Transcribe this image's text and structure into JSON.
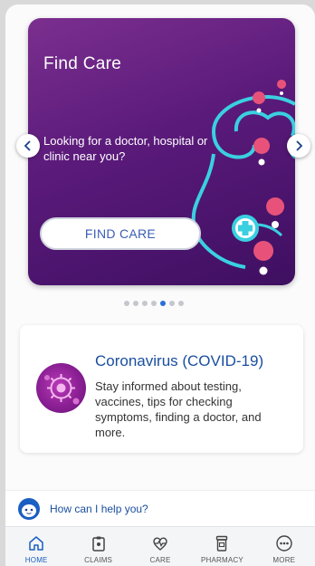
{
  "carousel": {
    "title": "Find Care",
    "description": "Looking for a doctor, hospital or clinic near you?",
    "button_label": "FIND CARE",
    "slide_count": 7,
    "active_slide": 5,
    "prev_icon": "chevron-left-icon",
    "next_icon": "chevron-right-icon"
  },
  "covid": {
    "title": "Coronavirus (COVID-19)",
    "text": "Stay informed about testing, vaccines, tips for checking symptoms, finding a doctor, and more.",
    "icon": "virus-icon"
  },
  "help": {
    "text": "How can I help you?",
    "icon": "assistant-avatar-icon"
  },
  "tabs": [
    {
      "label": "HOME",
      "icon": "home-icon",
      "active": true
    },
    {
      "label": "CLAIMS",
      "icon": "clipboard-icon",
      "active": false
    },
    {
      "label": "CARE",
      "icon": "heart-pulse-icon",
      "active": false
    },
    {
      "label": "PHARMACY",
      "icon": "pill-bottle-icon",
      "active": false
    },
    {
      "label": "MORE",
      "icon": "more-icon",
      "active": false
    }
  ],
  "colors": {
    "accent": "#1a5fc2",
    "card_purple": "#5a1a7a",
    "teal": "#3ad0e0",
    "pin_pink": "#e8527a"
  }
}
